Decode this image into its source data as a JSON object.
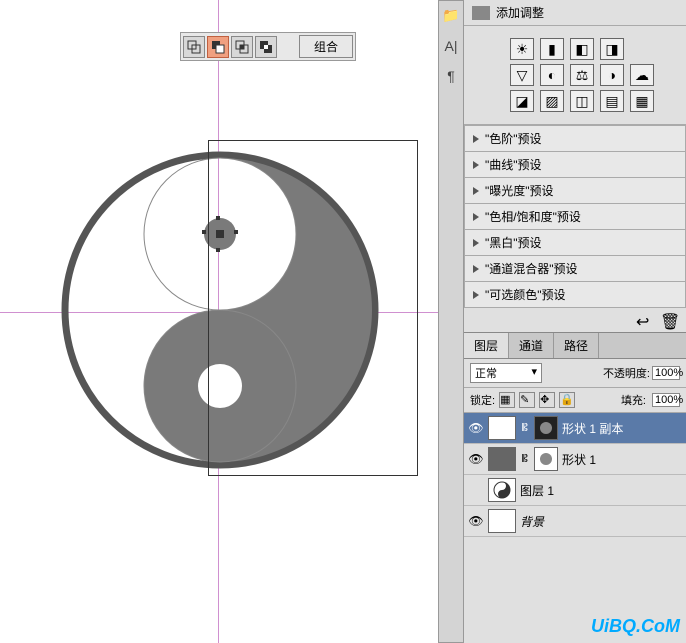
{
  "toolbar": {
    "combine_label": "组合"
  },
  "adjustments": {
    "title": "添加调整",
    "presets": [
      "\"色阶\"预设",
      "\"曲线\"预设",
      "\"曝光度\"预设",
      "\"色相/饱和度\"预设",
      "\"黑白\"预设",
      "\"通道混合器\"预设",
      "\"可选颜色\"预设"
    ]
  },
  "layers_panel": {
    "tabs": {
      "layers": "图层",
      "channels": "通道",
      "paths": "路径"
    },
    "blend_mode": "正常",
    "opacity_label": "不透明度:",
    "opacity_value": "100%",
    "lock_label": "锁定:",
    "fill_label": "填充:",
    "fill_value": "100%",
    "layers": [
      {
        "name": "形状 1 副本"
      },
      {
        "name": "形状 1"
      },
      {
        "name": "图层 1"
      },
      {
        "name": "背景"
      }
    ]
  },
  "watermark": "UiBQ.CoM",
  "icons": {
    "brightness": "☀",
    "levels": "▮",
    "curves": "◧",
    "exposure": "◨",
    "gradient": "▽",
    "hue": "◐",
    "balance": "⚖",
    "bw": "◑",
    "lookup": "☁",
    "invert": "◪",
    "poster": "▨",
    "thresh": "◫",
    "gradmap": "▤",
    "selcolor": "▦"
  }
}
